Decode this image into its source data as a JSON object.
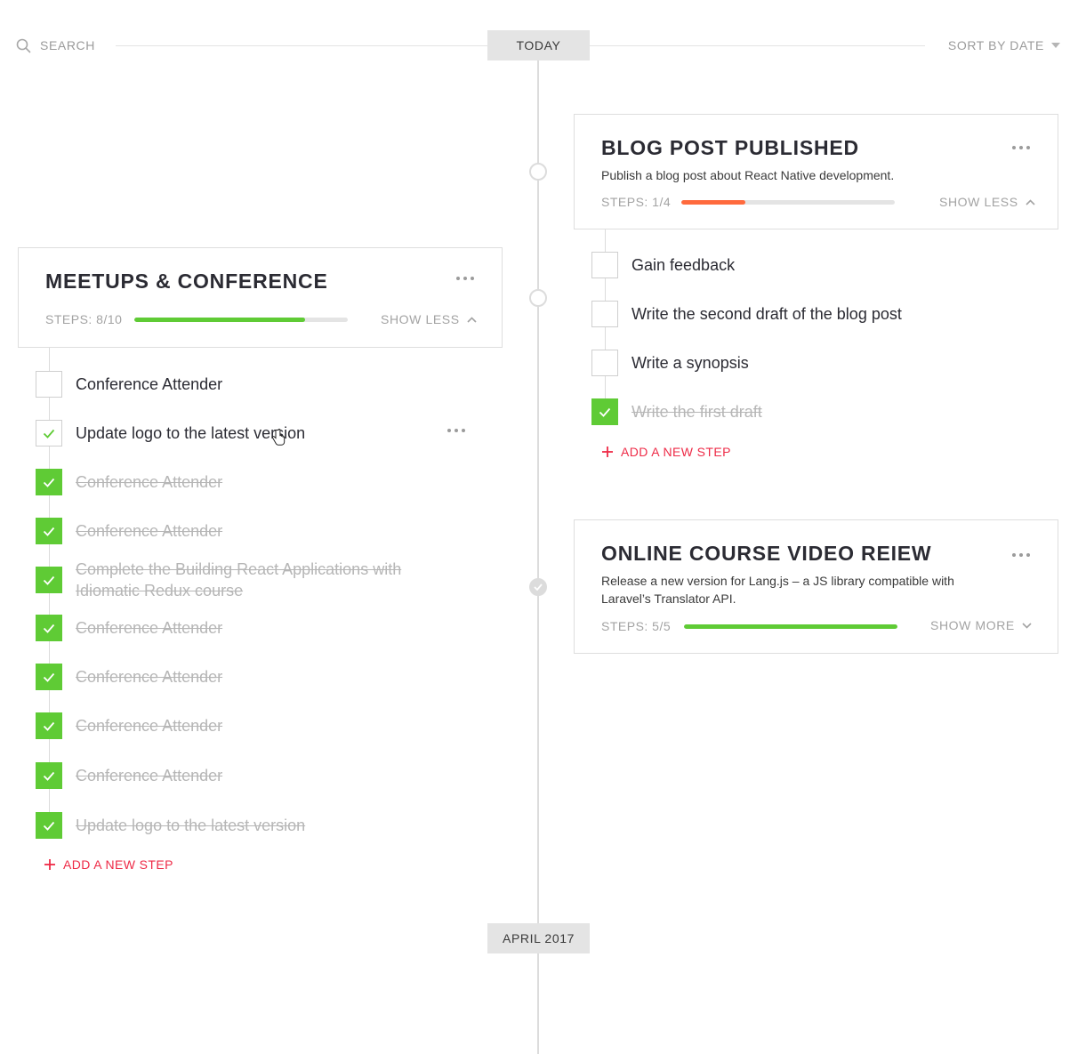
{
  "header": {
    "search_placeholder": "SEARCH",
    "today_label": "TODAY",
    "sort_label": "SORT BY DATE",
    "section_label": "APRIL 2017"
  },
  "colors": {
    "accent_red": "#ee2b47",
    "progress_green": "#5fcb35",
    "progress_orange": "#ff6a3d",
    "check_green": "#5fcb35",
    "timeline_gray": "#dcdcdc"
  },
  "icons": {
    "search": "search-icon",
    "sort_caret": "caret-down-icon",
    "more": "more-dots-icon",
    "expand": "chevron-up-icon",
    "collapse": "chevron-down-icon",
    "check": "check-icon",
    "add": "plus-icon",
    "cursor": "hand-cursor-icon"
  },
  "cards": [
    {
      "title": "BLOG POST PUBLISHED",
      "description": "Publish a blog post about React Native development.",
      "steps_label": "STEPS: 1/4",
      "progress": 0.3,
      "toggle_label": "SHOW LESS",
      "steps": [
        {
          "text": "Gain feedback",
          "done": false
        },
        {
          "text": "Write the second draft of the blog post",
          "done": false
        },
        {
          "text": "Write a synopsis",
          "done": false
        },
        {
          "text": "Write the first draft",
          "done": true
        }
      ],
      "add_step_label": "ADD A NEW STEP"
    },
    {
      "title": "MEETUPS & CONFERENCE",
      "description": "",
      "steps_label": "STEPS: 8/10",
      "progress": 0.8,
      "toggle_label": "SHOW LESS",
      "steps": [
        {
          "text": "Conference Attender",
          "done": false
        },
        {
          "text": "Update logo to the latest version",
          "done": false
        },
        {
          "text": "Conference Attender",
          "done": true
        },
        {
          "text": "Conference Attender",
          "done": true
        },
        {
          "text": "Complete the Building React Applications with Idiomatic Redux course",
          "done": true
        },
        {
          "text": "Conference Attender",
          "done": true
        },
        {
          "text": "Conference Attender",
          "done": true
        },
        {
          "text": "Conference Attender",
          "done": true
        },
        {
          "text": "Conference Attender",
          "done": true
        },
        {
          "text": "Update logo to the latest version",
          "done": true
        }
      ],
      "add_step_label": "ADD A NEW STEP"
    },
    {
      "title": "ONLINE COURSE VIDEO REIEW",
      "description": "Release a new version for Lang.js – a JS library compatible with Laravel’s Translator API.",
      "steps_label": "STEPS: 5/5",
      "progress": 1.0,
      "toggle_label": "SHOW MORE",
      "steps": []
    }
  ]
}
